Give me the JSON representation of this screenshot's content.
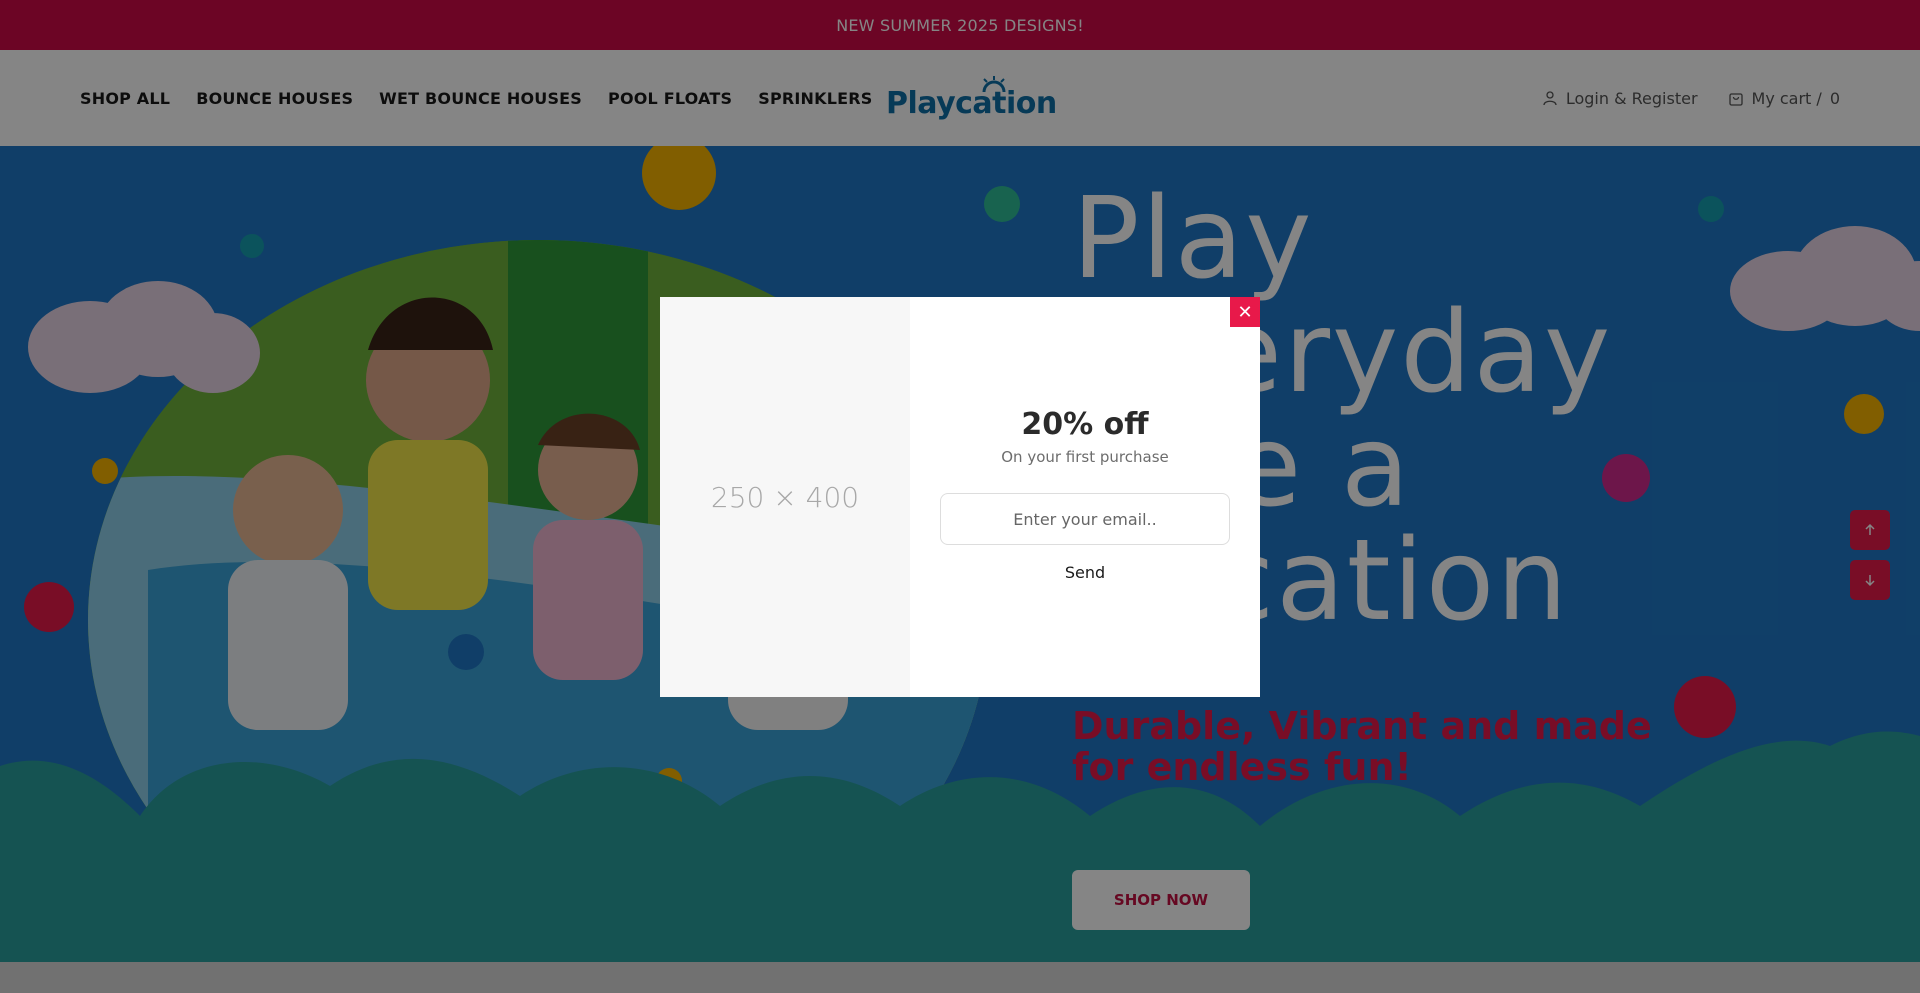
{
  "announcement": {
    "text": "NEW SUMMER 2025 DESIGNS!"
  },
  "nav": {
    "items": [
      {
        "label": "SHOP ALL"
      },
      {
        "label": "BOUNCE HOUSES"
      },
      {
        "label": "WET BOUNCE HOUSES"
      },
      {
        "label": "POOL FLOATS"
      },
      {
        "label": "SPRINKLERS"
      }
    ]
  },
  "brand": {
    "name": "Playcation",
    "color": "#0f6fa8"
  },
  "account": {
    "label": "Login & Register",
    "icon": "user-icon"
  },
  "cart": {
    "label": "My cart /",
    "count": "0",
    "icon": "shopping-bag-icon"
  },
  "hero": {
    "title_lines": [
      "Play",
      "Everyday",
      "Like a",
      "Vacation"
    ],
    "subtitle": "Durable, Vibrant and made for endless fun!",
    "cta_label": "SHOP NOW",
    "background_color": "#1f78c7",
    "accent_color": "#e8194a"
  },
  "scroll_controls": {
    "up_icon": "arrow-up-icon",
    "down_icon": "arrow-down-icon"
  },
  "popup": {
    "image_placeholder": "250 × 400",
    "title": "20% off",
    "subtitle": "On your first purchase",
    "email_placeholder": "Enter your email..",
    "send_label": "Send",
    "close_icon": "close-icon"
  }
}
